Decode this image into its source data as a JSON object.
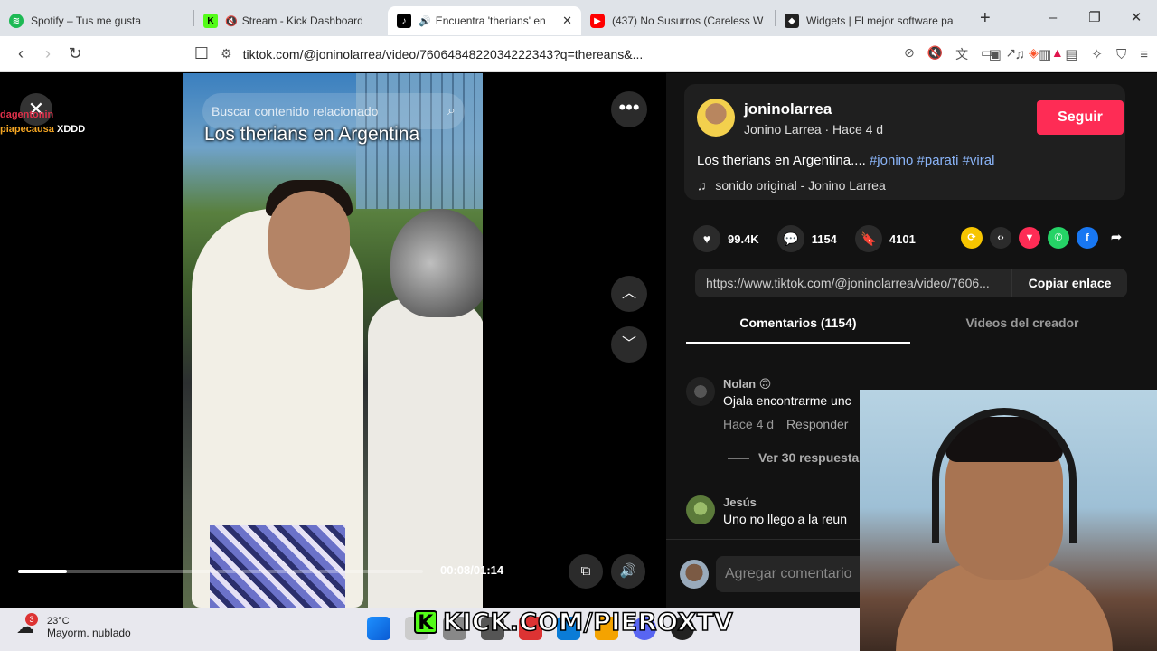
{
  "browser": {
    "tabs": [
      {
        "label": "Spotify – Tus me gusta",
        "color": "#1db954",
        "icon": "spotify-icon"
      },
      {
        "label": "Stream - Kick Dashboard",
        "color": "#53fc18",
        "icon": "kick-icon"
      },
      {
        "label": "Encuentra 'therians' en",
        "color": "#000000",
        "icon": "tiktok-icon"
      },
      {
        "label": "(437) No Susurros (Careless W",
        "color": "#ff0000",
        "icon": "youtube-icon"
      },
      {
        "label": "Widgets | El mejor software pa",
        "color": "#222222",
        "icon": "widgets-icon"
      }
    ],
    "url": "tiktok.com/@joninolarrea/video/7606484822034222343?q=thereans&..."
  },
  "stream_chat": {
    "line1_user": "dagentonin",
    "line2_user": "piapecausa",
    "line2_msg": "XDDD"
  },
  "video": {
    "search_placeholder": "Buscar contenido relacionado",
    "caption": "Los therians en Argentina",
    "time": "00:08/01:14",
    "progress": 0.12
  },
  "post": {
    "username": "joninolarrea",
    "subtitle": "Jonino Larrea · Hace 4 d",
    "follow_label": "Seguir",
    "description": "Los therians en Argentina....",
    "tags": [
      "#jonino",
      "#parati",
      "#viral"
    ],
    "music": "sonido original - Jonino Larrea",
    "likes": "99.4K",
    "comments": "1154",
    "saves": "4101",
    "link": "https://www.tiktok.com/@joninolarrea/video/7606...",
    "copy_label": "Copiar enlace"
  },
  "panel_tabs": {
    "comments": "Comentarios (1154)",
    "creator_videos": "Videos del creador"
  },
  "comments": [
    {
      "name": "Nolan 🙃",
      "text": "Ojala encontrarme unc",
      "time": "Hace 4 d",
      "reply": "Responder"
    },
    {
      "name": "Jesús",
      "text": "Uno no llego a la reun"
    }
  ],
  "more_replies": "Ver 30 respuesta",
  "add_comment_placeholder": "Agregar comentario",
  "taskbar": {
    "temp": "23°C",
    "weather": "Mayorm. nublado",
    "badge": "3"
  },
  "overlay_text": "KICK.COM/PIEROXTV"
}
